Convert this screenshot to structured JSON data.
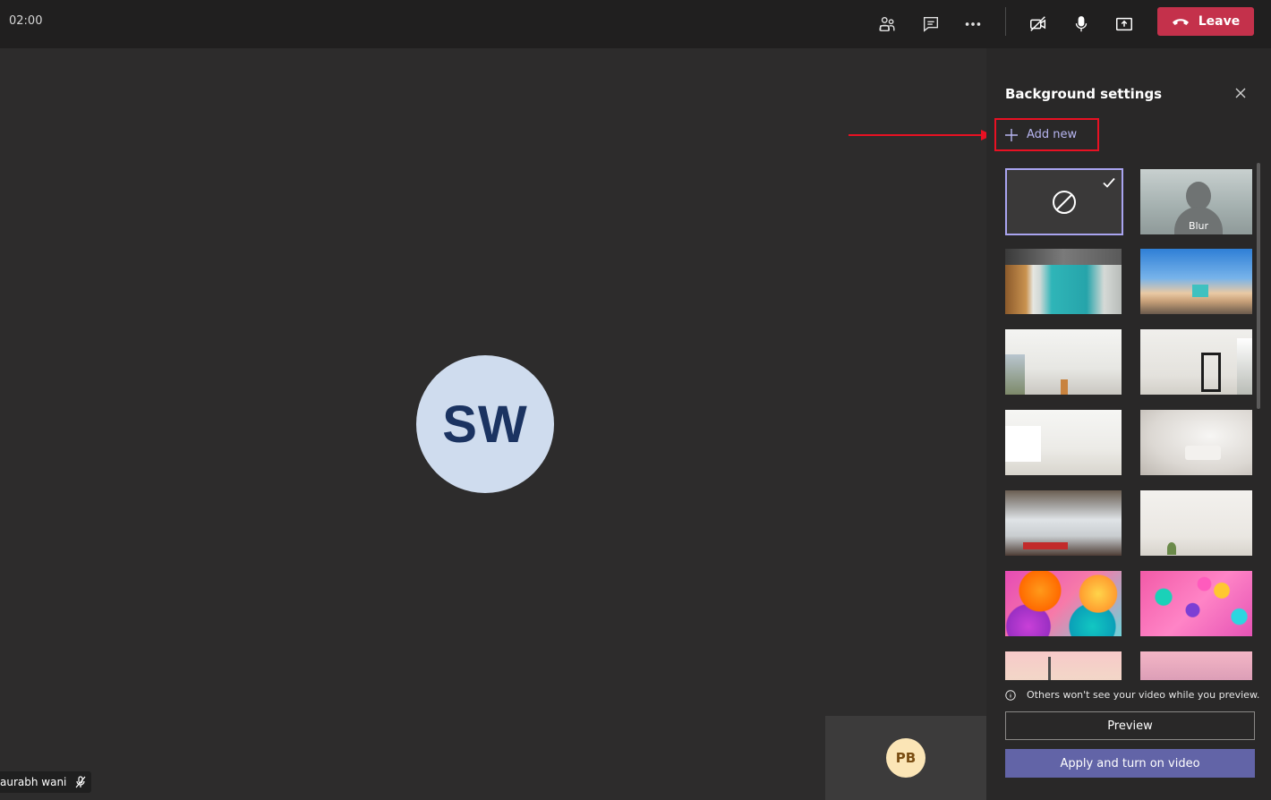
{
  "header": {
    "timer": "02:00",
    "icons": [
      "participants-icon",
      "chat-icon",
      "more-options-icon",
      "camera-off-icon",
      "microphone-icon",
      "share-screen-icon"
    ],
    "leave_label": "Leave",
    "leave_color": "#c4314b"
  },
  "stage": {
    "main_avatar_initials": "SW",
    "name_tag": "aurabh wani",
    "self_avatar_initials": "PB"
  },
  "panel": {
    "title": "Background settings",
    "add_new_label": "Add new",
    "thumbnails": [
      {
        "id": "none",
        "label": "",
        "selected": true
      },
      {
        "id": "blur",
        "label": "Blur",
        "selected": false
      },
      {
        "id": "office-lockers",
        "label": "",
        "selected": false
      },
      {
        "id": "beach-lifeguard",
        "label": "",
        "selected": false
      },
      {
        "id": "white-room-1",
        "label": "",
        "selected": false
      },
      {
        "id": "white-room-mirror",
        "label": "",
        "selected": false
      },
      {
        "id": "white-room-bright",
        "label": "",
        "selected": false
      },
      {
        "id": "white-room-bed",
        "label": "",
        "selected": false
      },
      {
        "id": "loft-city",
        "label": "",
        "selected": false
      },
      {
        "id": "white-wall-plant",
        "label": "",
        "selected": false
      },
      {
        "id": "balloons-orange",
        "label": "",
        "selected": false
      },
      {
        "id": "balloons-pink",
        "label": "",
        "selected": false
      },
      {
        "id": "pastel-bridge",
        "label": "",
        "selected": false
      },
      {
        "id": "pastel-mountains",
        "label": "",
        "selected": false
      }
    ],
    "notice": "Others won't see your video while you preview.",
    "preview_label": "Preview",
    "apply_label": "Apply and turn on video",
    "accent_color": "#6264a7",
    "highlight_color": "#e81123"
  }
}
